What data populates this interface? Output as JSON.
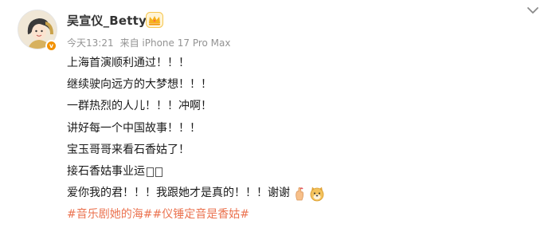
{
  "post": {
    "username": "吴宣仪_Betty",
    "badge": "v",
    "meta": {
      "time": "今天13:21",
      "source": "来自 iPhone 17 Pro Max"
    },
    "lines": [
      "上海首演顺利通过！！！",
      "继续驶向远方的大梦想！！！",
      "一群热烈的人儿！！！冲啊！",
      "讲好每一个中国故事！！！",
      "宝玉哥哥来看石香姑了！",
      "接石香姑事业运"
    ],
    "last_line": "爱你我的君！！！我跟她才是真的！！！谢谢",
    "hashtags": [
      "#音乐剧她的海#",
      "#仪锤定音是香姑#"
    ]
  },
  "colors": {
    "hashtag": "#eb7350",
    "meta": "#939393",
    "badge": "#f29100",
    "crown": "#f6b11b"
  },
  "icons": {
    "avatar": "cartoon-girl-avatar",
    "verified": "verified-badge-icon",
    "crown": "crown-icon",
    "menu": "chevron-down-icon",
    "hand": "pinched-fingers-emoji",
    "doge": "doge-emoji"
  }
}
